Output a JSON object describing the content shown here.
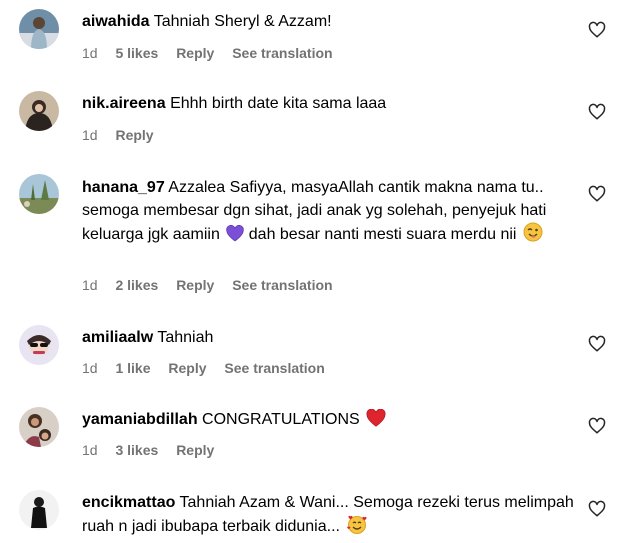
{
  "comments": [
    {
      "username": "aiwahida",
      "text": "Tahniah Sheryl & Azzam!",
      "age": "1d",
      "likes": "5 likes",
      "reply": "Reply",
      "translate": "See translation",
      "avatar_icon": "avatar-aiwahida"
    },
    {
      "username": "nik.aireena",
      "text": "Ehhh birth date kita sama laaa",
      "age": "1d",
      "reply": "Reply",
      "avatar_icon": "avatar-nik-aireena"
    },
    {
      "username": "hanana_97",
      "text": "Azzalea Safiyya, masyaAllah cantik makna nama tu.. semoga membesar dgn sihat, jadi anak yg solehah, penyejuk hati keluarga jgk aamiin",
      "text_after": "dah besar nanti mesti suara merdu nii",
      "emoji_1": "purple-heart",
      "emoji_2": "winking-face",
      "age": "1d",
      "likes": "2 likes",
      "reply": "Reply",
      "translate": "See translation",
      "avatar_icon": "avatar-hanana-97"
    },
    {
      "username": "amiliaalw",
      "text": "Tahniah",
      "age": "1d",
      "likes": "1 like",
      "reply": "Reply",
      "translate": "See translation",
      "avatar_icon": "avatar-amiliaalw"
    },
    {
      "username": "yamaniabdillah",
      "text": "CONGRATULATIONS",
      "emoji_1": "red-heart",
      "age": "1d",
      "likes": "3 likes",
      "reply": "Reply",
      "avatar_icon": "avatar-yamaniabdillah"
    },
    {
      "username": "encikmattao",
      "text": "Tahniah Azam & Wani... Semoga rezeki terus melimpah ruah n jadi ibubapa terbaik didunia...",
      "emoji_1": "smiling-face-with-hearts",
      "avatar_icon": "avatar-encikmattao"
    }
  ],
  "colors": {
    "meta": "#737373",
    "text": "#000000",
    "background": "#ffffff"
  }
}
